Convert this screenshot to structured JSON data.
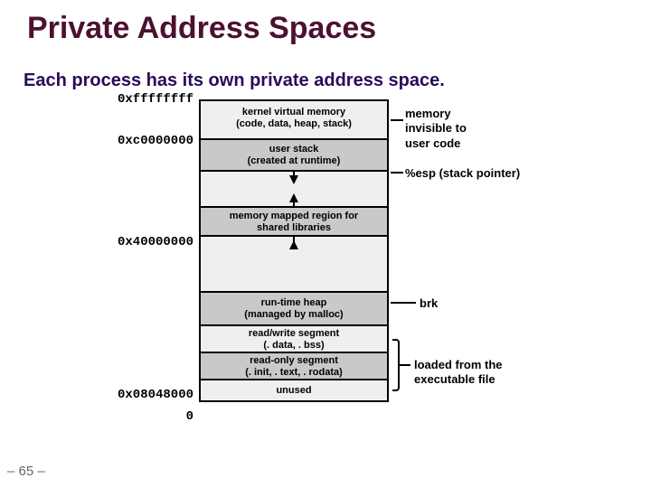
{
  "title": "Private Address Spaces",
  "subtitle": "Each process has its own private address space.",
  "slidenum": "– 65 –",
  "addresses": {
    "top": "0xffffffff",
    "kernel_base": "0xc0000000",
    "mmap_base": "0x40000000",
    "text_base": "0x08048000",
    "zero": "0"
  },
  "segments": {
    "kernel_l1": "kernel virtual memory",
    "kernel_l2": "(code, data, heap, stack)",
    "ustack_l1": "user stack",
    "ustack_l2": "(created at runtime)",
    "mmap_l1": "memory mapped region for",
    "mmap_l2": "shared libraries",
    "heap_l1": "run-time heap",
    "heap_l2": "(managed by malloc)",
    "rw_l1": "read/write segment",
    "rw_l2": "(. data, . bss)",
    "ro_l1": "read-only segment",
    "ro_l2": "(. init, . text, . rodata)",
    "unused": "unused"
  },
  "notes": {
    "invisible_l1": "memory",
    "invisible_l2": "invisible to",
    "invisible_l3": "user code",
    "esp": "%esp (stack pointer)",
    "brk": "brk",
    "loaded_l1": "loaded from the",
    "loaded_l2": "executable file"
  }
}
